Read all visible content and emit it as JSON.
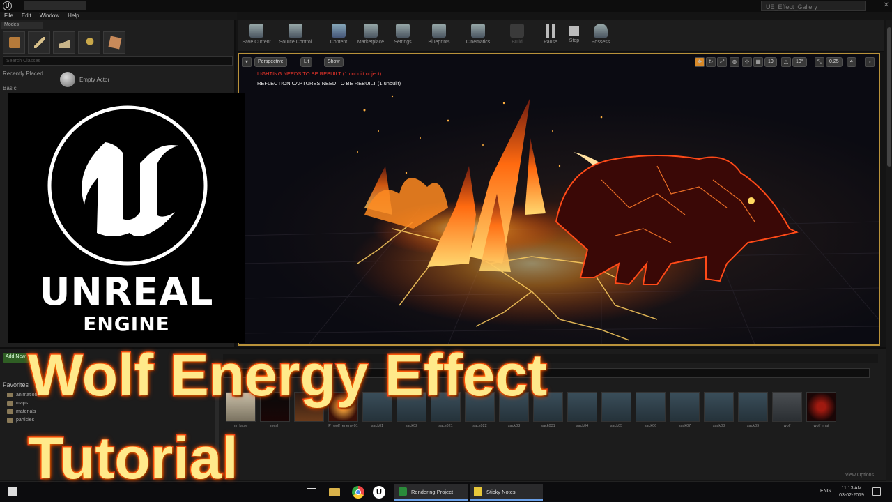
{
  "window": {
    "project_name": "UE_Effect_Gallery",
    "close_icon": "close-icon"
  },
  "menu": [
    "File",
    "Edit",
    "Window",
    "Help"
  ],
  "modes": {
    "tab_label": "Modes",
    "search_placeholder": "Search Classes",
    "recently_placed": "Recently Placed",
    "basic": "Basic",
    "empty_actor": "Empty Actor"
  },
  "logo": {
    "word": "UNREAL",
    "sub": "ENGINE"
  },
  "toolbar": {
    "buttons": [
      {
        "label": "Save Current",
        "icon": "save-icon"
      },
      {
        "label": "Source Control",
        "icon": "source-control-icon"
      },
      {
        "label": "Content",
        "icon": "content-icon"
      },
      {
        "label": "Marketplace",
        "icon": "marketplace-icon"
      },
      {
        "label": "Settings",
        "icon": "settings-icon"
      },
      {
        "label": "Blueprints",
        "icon": "blueprints-icon"
      },
      {
        "label": "Cinematics",
        "icon": "cinematics-icon"
      },
      {
        "label": "Build",
        "icon": "build-icon"
      },
      {
        "label": "Pause",
        "icon": "pause-icon"
      },
      {
        "label": "Stop",
        "icon": "stop-icon"
      },
      {
        "label": "Possess",
        "icon": "possess-icon"
      }
    ]
  },
  "viewport": {
    "perspective": "Perspective",
    "lit": "Lit",
    "show": "Show",
    "grid_snap": "10",
    "rotation_snap": "10°",
    "scale_snap": "0.25",
    "camera_speed": "4",
    "warning_lighting": "LIGHTING NEEDS TO BE REBUILT (1 unbuilt object)",
    "warning_reflection": "REFLECTION CAPTURES NEED TO BE REBUILT (1 unbuilt)",
    "border_color": "#b9923a"
  },
  "content_browser": {
    "add_new": "Add New",
    "favorites": "Favorites",
    "folders": [
      "animations",
      "maps",
      "materials",
      "particles"
    ],
    "path_folder": "wolf",
    "assets": [
      "m_base",
      "mesh",
      "",
      "P_wolf_energy01",
      "sack01",
      "sack02",
      "sack021",
      "sack022",
      "sack03",
      "sack031",
      "sack04",
      "sack05",
      "sack06",
      "sack07",
      "sack08",
      "sack09",
      "wolf",
      "wolf_mat"
    ],
    "view_options": "View Options"
  },
  "taskbar": {
    "apps": [
      {
        "label": "Rendering Project",
        "icon": "rendering-project-icon"
      },
      {
        "label": "Sticky Notes",
        "icon": "sticky-notes-icon"
      }
    ],
    "lang": "ENG",
    "time": "11:13 AM",
    "date": "03-02-2019"
  },
  "title": {
    "line1": "Wolf Energy Effect",
    "line2": "Tutorial",
    "fill_color": "#ffe98a",
    "stroke_color": "#e8341c"
  }
}
